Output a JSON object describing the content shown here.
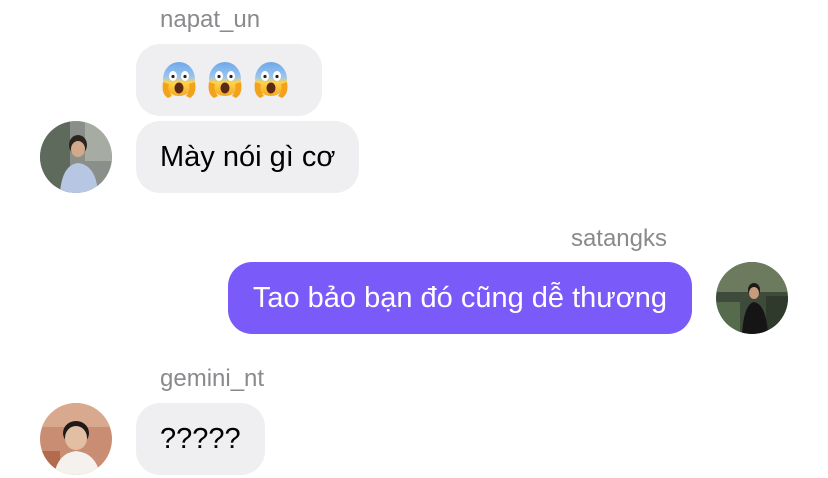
{
  "messages": [
    {
      "sender": "napat_un",
      "bubbles": [
        {
          "type": "emoji",
          "icons": [
            "face-screaming-in-fear-icon",
            "face-screaming-in-fear-icon",
            "face-screaming-in-fear-icon"
          ]
        },
        {
          "type": "text",
          "text": "Mày nói gì cơ"
        }
      ]
    },
    {
      "sender": "satangks",
      "bubbles": [
        {
          "type": "text",
          "text": "Tao bảo bạn đó cũng dễ thương"
        }
      ]
    },
    {
      "sender": "gemini_nt",
      "bubbles": [
        {
          "type": "text",
          "text": "?????"
        }
      ]
    }
  ],
  "colors": {
    "incoming_bubble": "#efeff1",
    "outgoing_bubble": "#7a5af8",
    "sender_name": "#8a8a8e"
  }
}
